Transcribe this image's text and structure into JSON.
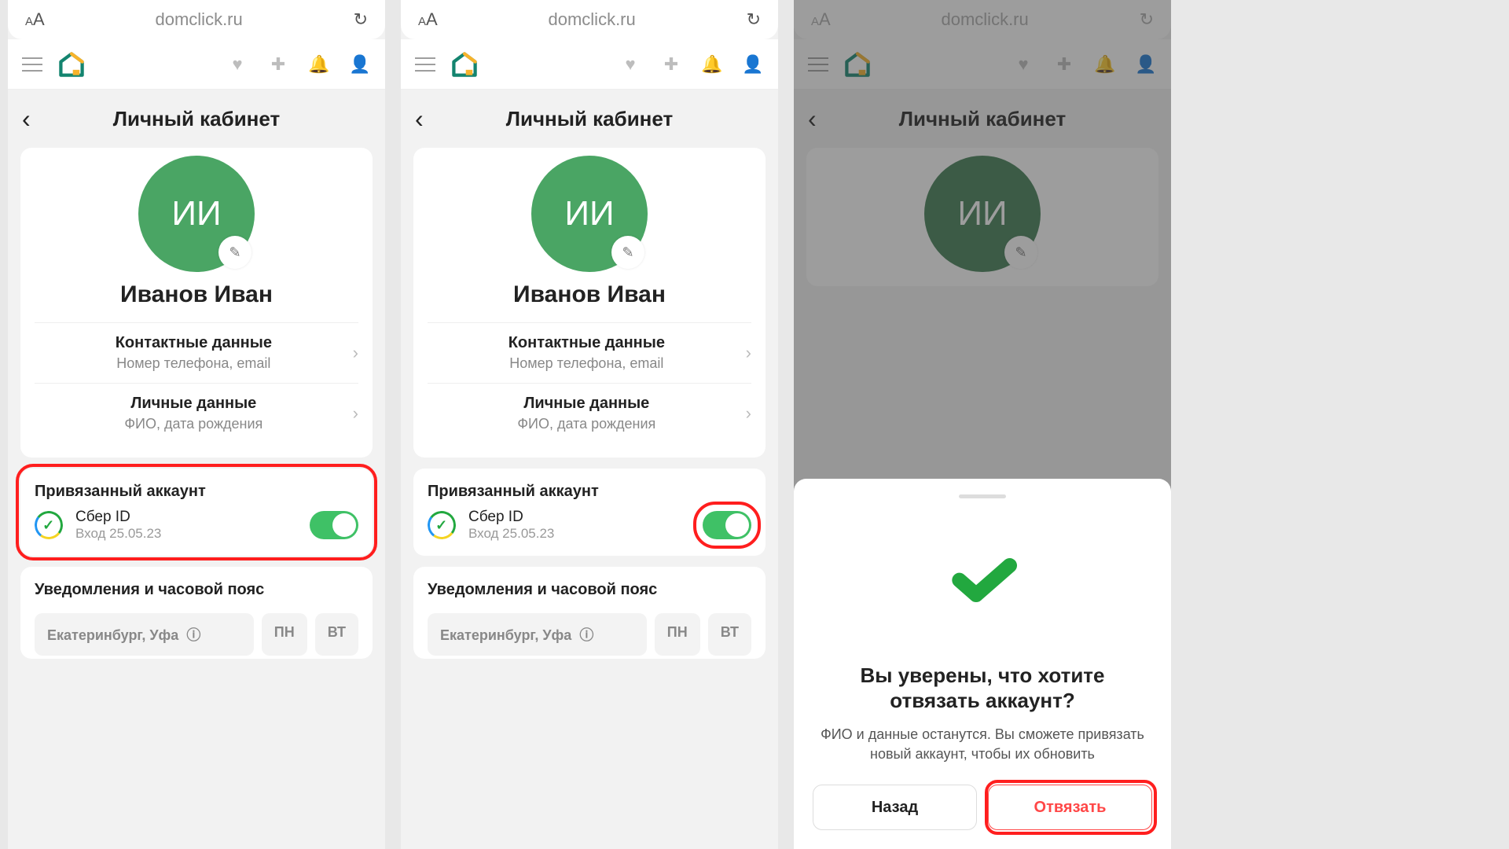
{
  "browser": {
    "url": "domclick.ru",
    "aa_small": "A",
    "aa_big": "A"
  },
  "header": {
    "title": "Личный кабинет"
  },
  "profile": {
    "initials": "ИИ",
    "name": "Иванов Иван"
  },
  "menu": {
    "contact": {
      "title": "Контактные данные",
      "sub": "Номер телефона, email"
    },
    "personal": {
      "title": "Личные данные",
      "sub": "ФИО, дата рождения"
    }
  },
  "linked": {
    "section_title": "Привязанный аккаунт",
    "provider": "Сбер ID",
    "login_info": "Вход 25.05.23"
  },
  "notifications": {
    "title": "Уведомления и часовой пояс",
    "city": "Екатеринбург, Уфа",
    "day1": "ПН",
    "day2": "ВТ"
  },
  "modal": {
    "title": "Вы уверены, что хотите отвязать аккаунт?",
    "body": "ФИО и данные останутся. Вы сможете привязать новый аккаунт, чтобы их обновить",
    "back": "Назад",
    "unlink": "Отвязать"
  }
}
